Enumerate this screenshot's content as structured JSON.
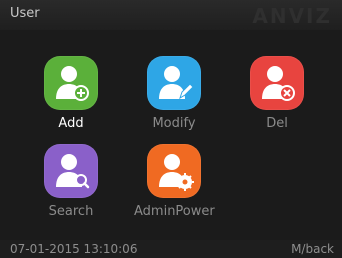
{
  "header": {
    "title": "User",
    "brand_logo": "ANVIZ"
  },
  "menu": {
    "items": [
      {
        "label": "Add",
        "icon": "user-add-icon",
        "color": "#5bb03a"
      },
      {
        "label": "Modify",
        "icon": "user-edit-icon",
        "color": "#2ea6e6"
      },
      {
        "label": "Del",
        "icon": "user-delete-icon",
        "color": "#e8443f"
      },
      {
        "label": "Search",
        "icon": "user-search-icon",
        "color": "#8a60c9"
      },
      {
        "label": "AdminPower",
        "icon": "user-settings-icon",
        "color": "#f06a22"
      }
    ],
    "selected": "Add"
  },
  "status": {
    "datetime": "07-01-2015 13:10:06",
    "back_hint": "M/back"
  }
}
